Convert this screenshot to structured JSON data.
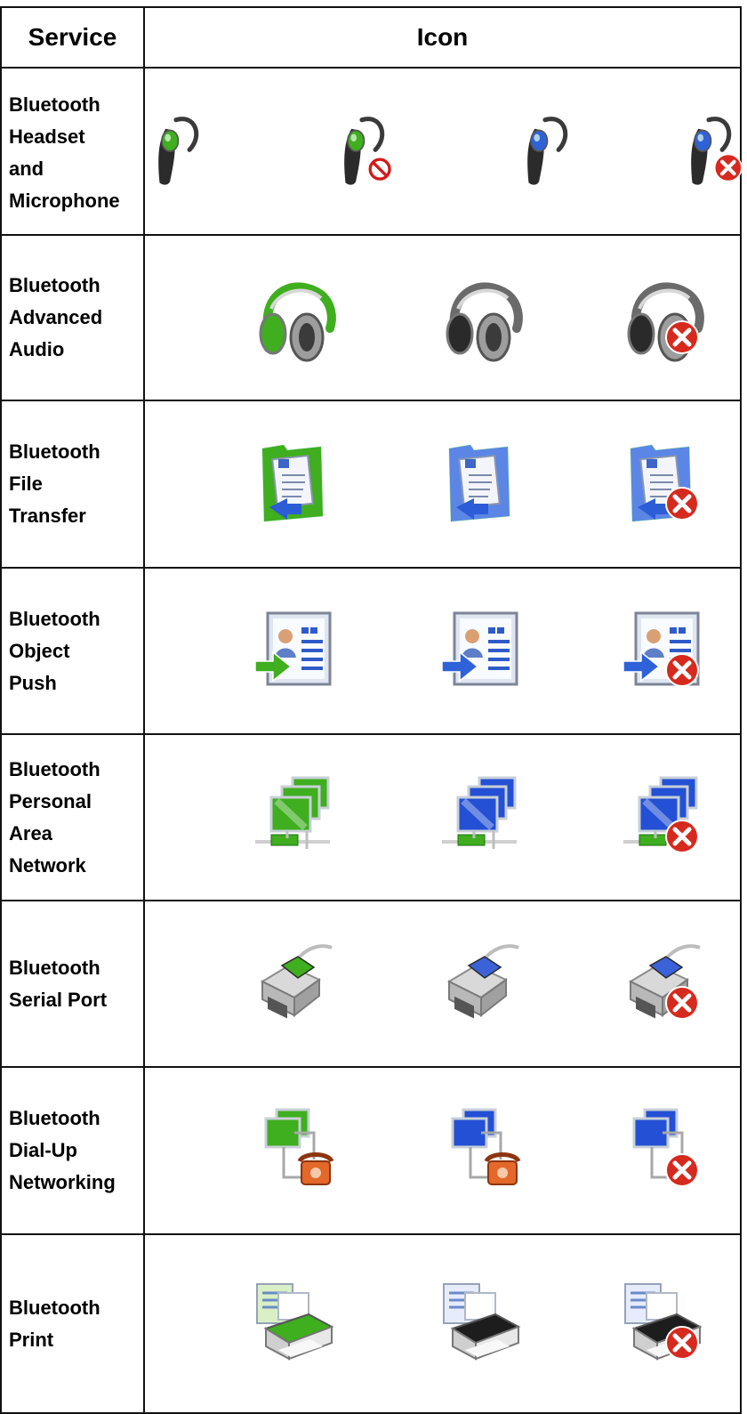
{
  "header": {
    "service": "Service",
    "icon": "Icon"
  },
  "colors": {
    "connected_green": "#3fae1f",
    "idle_blue": "#2f62d8",
    "error_red": "#d62a1e",
    "grey": "#9a9a9a",
    "dark": "#2a2a2a"
  },
  "rows": [
    {
      "service_lines": [
        "Bluetooth",
        "Headset",
        "and",
        "Microphone"
      ],
      "icon": "headset-icon",
      "states": [
        "connected",
        "disabled",
        "idle",
        "error"
      ]
    },
    {
      "service_lines": [
        "Bluetooth",
        "Advanced",
        "Audio"
      ],
      "icon": "headphones-icon",
      "states": [
        "connected",
        "idle",
        "error"
      ]
    },
    {
      "service_lines": [
        "Bluetooth",
        "File",
        "Transfer"
      ],
      "icon": "file-transfer-folder-icon",
      "states": [
        "connected",
        "idle",
        "error"
      ]
    },
    {
      "service_lines": [
        "Bluetooth",
        "Object",
        "Push"
      ],
      "icon": "object-push-icon",
      "states": [
        "connected",
        "idle",
        "error"
      ]
    },
    {
      "service_lines": [
        "Bluetooth",
        "Personal",
        "Area",
        "Network"
      ],
      "icon": "network-computers-icon",
      "states": [
        "connected",
        "idle",
        "error"
      ]
    },
    {
      "service_lines": [
        "Bluetooth",
        "Serial Port"
      ],
      "icon": "serial-port-icon",
      "states": [
        "connected",
        "idle",
        "error"
      ]
    },
    {
      "service_lines": [
        "Bluetooth",
        "Dial-Up",
        "Networking"
      ],
      "icon": "dial-up-networking-icon",
      "states": [
        "connected",
        "idle",
        "error"
      ]
    },
    {
      "service_lines": [
        "Bluetooth",
        "Print"
      ],
      "icon": "printer-icon",
      "states": [
        "connected",
        "idle",
        "error"
      ]
    }
  ]
}
